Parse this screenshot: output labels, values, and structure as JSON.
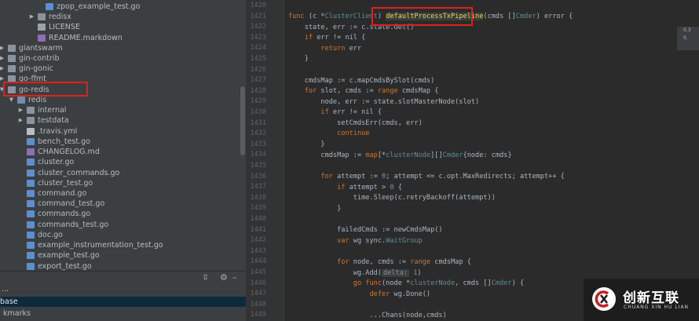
{
  "project_tree": {
    "rows": [
      {
        "label": "zpop_example_test.go",
        "kind": "file-go",
        "arrow": ""
      },
      {
        "label": "redisx",
        "kind": "folder",
        "arrow": "▶"
      },
      {
        "label": "LICENSE",
        "kind": "file-lic",
        "arrow": ""
      },
      {
        "label": "README.markdown",
        "kind": "file-md",
        "arrow": ""
      },
      {
        "label": "giantswarm",
        "kind": "folder",
        "arrow": "▶"
      },
      {
        "label": "gin-contrib",
        "kind": "folder",
        "arrow": "▶"
      },
      {
        "label": "gin-gonic",
        "kind": "folder",
        "arrow": "▶"
      },
      {
        "label": "go-ffmt",
        "kind": "folder",
        "arrow": "▶"
      },
      {
        "label": "go-redis",
        "kind": "folder",
        "arrow": "▼"
      },
      {
        "label": "redis",
        "kind": "folder src",
        "arrow": "▼"
      },
      {
        "label": "internal",
        "kind": "folder",
        "arrow": "▶"
      },
      {
        "label": "testdata",
        "kind": "folder",
        "arrow": "▶"
      },
      {
        "label": ".travis.yml",
        "kind": "file-yml",
        "arrow": ""
      },
      {
        "label": "bench_test.go",
        "kind": "file-go",
        "arrow": ""
      },
      {
        "label": "CHANGELOG.md",
        "kind": "file-md",
        "arrow": ""
      },
      {
        "label": "cluster.go",
        "kind": "file-go",
        "arrow": ""
      },
      {
        "label": "cluster_commands.go",
        "kind": "file-go",
        "arrow": ""
      },
      {
        "label": "cluster_test.go",
        "kind": "file-go",
        "arrow": ""
      },
      {
        "label": "command.go",
        "kind": "file-go",
        "arrow": ""
      },
      {
        "label": "command_test.go",
        "kind": "file-go",
        "arrow": ""
      },
      {
        "label": "commands.go",
        "kind": "file-go",
        "arrow": ""
      },
      {
        "label": "commands_test.go",
        "kind": "file-go",
        "arrow": ""
      },
      {
        "label": "doc.go",
        "kind": "file-go",
        "arrow": ""
      },
      {
        "label": "example_instrumentation_test.go",
        "kind": "file-go",
        "arrow": ""
      },
      {
        "label": "example_test.go",
        "kind": "file-go",
        "arrow": ""
      },
      {
        "label": "export_test.go",
        "kind": "file-go",
        "arrow": ""
      }
    ]
  },
  "bottom_panel": {
    "toolbar": {
      "collapse_icon": "split-icon",
      "settings_icon": "gear-icon",
      "hide_icon": "minimize-icon"
    },
    "rows": [
      {
        "label": "...",
        "selected": false
      },
      {
        "label": "base",
        "selected": true
      },
      {
        "label": "kmarks",
        "selected": false
      }
    ]
  },
  "editor": {
    "line_numbers": [
      "1420",
      "1421",
      "1422",
      "1423",
      "1424",
      "1425",
      "1426",
      "1427",
      "1428",
      "1429",
      "1430",
      "1431",
      "1432",
      "1433",
      "1434",
      "1435",
      "1436",
      "1437",
      "1438",
      "1439",
      "1440",
      "1441",
      "1442",
      "1443",
      "1444",
      "1445",
      "1446",
      "1447",
      "1448",
      "1449"
    ],
    "code": {
      "l1421_a": "func",
      "l1421_b": " (c *",
      "l1421_c": "ClusterClient",
      "l1421_d": ") ",
      "l1421_e": "defaultProcessTxPipeline",
      "l1421_f": "(cmds []",
      "l1421_g": "Cmder",
      "l1421_h": ") ",
      "l1421_i": "error",
      "l1421_j": " {",
      "l1422": "    state, err := c.state.Get()",
      "l1423_a": "    if",
      "l1423_b": " err != nil {",
      "l1424_a": "        return",
      "l1424_b": " err",
      "l1425": "    }",
      "l1427": "    cmdsMap := c.mapCmdsBySlot(cmds)",
      "l1428_a": "    for",
      "l1428_b": " slot, cmds := ",
      "l1428_c": "range",
      "l1428_d": " cmdsMap {",
      "l1429": "        node, err := state.slotMasterNode(slot)",
      "l1430_a": "        if",
      "l1430_b": " err != nil {",
      "l1431": "            setCmdsErr(cmds, err)",
      "l1432": "            continue",
      "l1433": "        }",
      "l1434_a": "        cmdsMap := ",
      "l1434_b": "map",
      "l1434_c": "[*",
      "l1434_d": "clusterNode",
      "l1434_e": "][]",
      "l1434_f": "Cmder",
      "l1434_g": "{node: cmds}",
      "l1436_a": "        for",
      "l1436_b": " attempt := ",
      "l1436_c": "0",
      "l1436_d": "; attempt <= c.opt.MaxRedirects; attempt++ {",
      "l1437_a": "            if",
      "l1437_b": " attempt > ",
      "l1437_c": "0",
      "l1437_d": " {",
      "l1438": "                time.Sleep(c.retryBackoff(attempt))",
      "l1439": "            }",
      "l1441": "            failedCmds := newCmdsMap()",
      "l1442_a": "            var",
      "l1442_b": " wg sync.",
      "l1442_c": "WaitGroup",
      "l1444_a": "            for",
      "l1444_b": " node, cmds := ",
      "l1444_c": "range",
      "l1444_d": " cmdsMap {",
      "l1445_a": "                wg.Add(",
      "l1445_b": "delta:",
      "l1445_c": " 1",
      "l1445_d": ")",
      "l1446_a": "                go func",
      "l1446_b": "(node *",
      "l1446_c": "clusterNode",
      "l1446_d": ", cmds []",
      "l1446_e": "Cmder",
      "l1446_f": ") {",
      "l1447_a": "                    defer",
      "l1447_b": " wg.Done()",
      "l1449": "                    ...Chans(node,cmds)"
    }
  },
  "right_panel": {
    "line1": "0.3",
    "line2": "0."
  },
  "watermark": {
    "title": "创新互联",
    "subtitle": "CHUANG XIN HU LIAN"
  },
  "colors": {
    "keyword": "#cc7832",
    "function": "#ffc66d",
    "type": "#6897bb",
    "annotation": "#e02020"
  }
}
